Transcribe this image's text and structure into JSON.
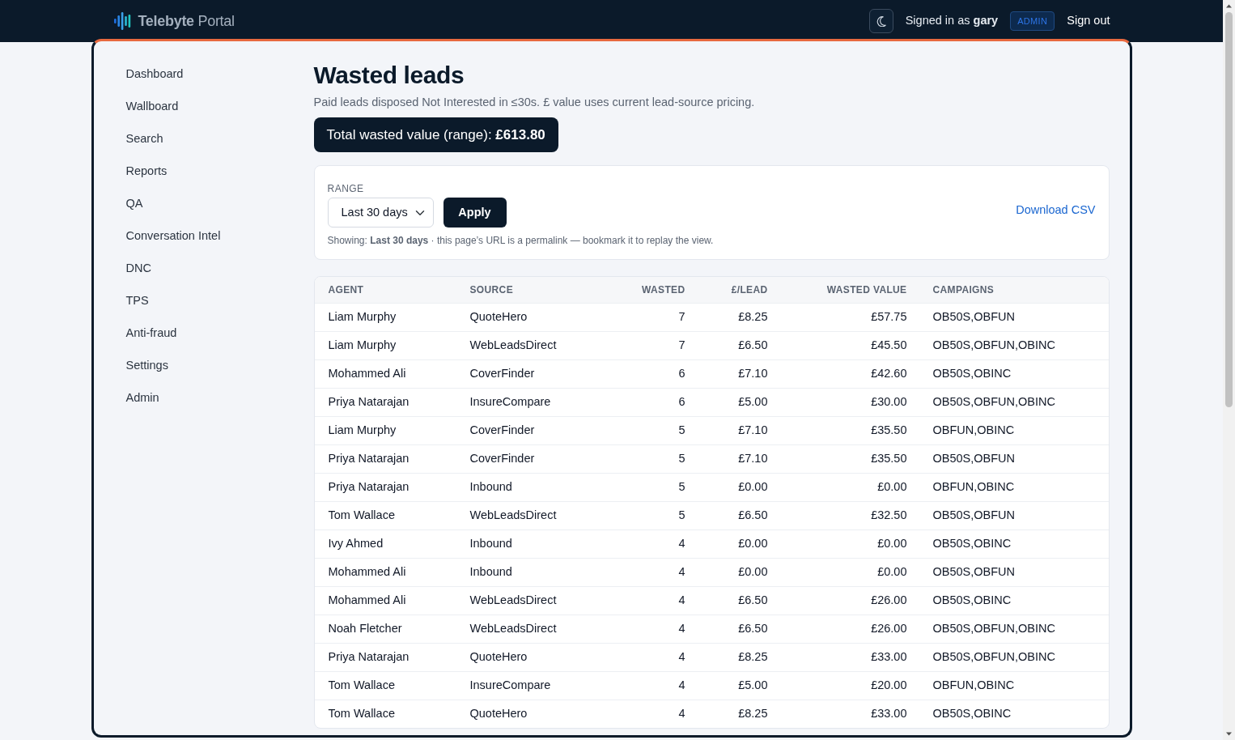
{
  "navbar": {
    "brand": "**Telebyte** Portal",
    "signed_in": "Signed in as **gary**",
    "role_badge": "ADMIN",
    "sign_out": "Sign out"
  },
  "sidebar": {
    "items": [
      {
        "label": "Dashboard",
        "selected": false
      },
      {
        "label": "Wallboard",
        "selected": false
      },
      {
        "label": "Search",
        "selected": false
      },
      {
        "label": "Reports",
        "selected": false
      },
      {
        "label": "QA",
        "selected": false
      },
      {
        "label": "Conversation Intel",
        "selected": false
      },
      {
        "label": "DNC",
        "selected": false
      },
      {
        "label": "TPS",
        "selected": false
      },
      {
        "label": "Anti-fraud",
        "selected": false
      },
      {
        "label": "Settings",
        "selected": false
      },
      {
        "label": "Admin",
        "selected": false
      }
    ]
  },
  "page": {
    "title": "Wasted leads",
    "subtitle": "Paid leads disposed Not Interested in ≤30s. £ value uses current lead-source pricing.",
    "total": "Total wasted value (range): **£613.80**"
  },
  "filter": {
    "label": "RANGE",
    "value": "Last 30 days",
    "apply": "Apply",
    "download": "Download CSV",
    "note": "Showing: **Last 30 days** · this page’s URL is a permalink — bookmark it to replay the view."
  },
  "table": {
    "columns": [
      {
        "label": "AGENT",
        "kind": "text"
      },
      {
        "label": "SOURCE",
        "kind": "text"
      },
      {
        "label": "WASTED",
        "kind": "number"
      },
      {
        "label": "£/LEAD",
        "kind": "number"
      },
      {
        "label": "WASTED VALUE",
        "kind": "number"
      },
      {
        "label": "CAMPAIGNS",
        "kind": "text"
      }
    ],
    "rows": [
      [
        "Liam Murphy",
        "QuoteHero",
        "7",
        "£8.25",
        "£57.75",
        "OB50S,OBFUN"
      ],
      [
        "Liam Murphy",
        "WebLeadsDirect",
        "7",
        "£6.50",
        "£45.50",
        "OB50S,OBFUN,OBINC"
      ],
      [
        "Mohammed Ali",
        "CoverFinder",
        "6",
        "£7.10",
        "£42.60",
        "OB50S,OBINC"
      ],
      [
        "Priya Natarajan",
        "InsureCompare",
        "6",
        "£5.00",
        "£30.00",
        "OB50S,OBFUN,OBINC"
      ],
      [
        "Liam Murphy",
        "CoverFinder",
        "5",
        "£7.10",
        "£35.50",
        "OBFUN,OBINC"
      ],
      [
        "Priya Natarajan",
        "CoverFinder",
        "5",
        "£7.10",
        "£35.50",
        "OB50S,OBFUN"
      ],
      [
        "Priya Natarajan",
        "Inbound",
        "5",
        "£0.00",
        "£0.00",
        "OBFUN,OBINC"
      ],
      [
        "Tom Wallace",
        "WebLeadsDirect",
        "5",
        "£6.50",
        "£32.50",
        "OB50S,OBFUN"
      ],
      [
        "Ivy Ahmed",
        "Inbound",
        "4",
        "£0.00",
        "£0.00",
        "OB50S,OBINC"
      ],
      [
        "Mohammed Ali",
        "Inbound",
        "4",
        "£0.00",
        "£0.00",
        "OB50S,OBFUN"
      ],
      [
        "Mohammed Ali",
        "WebLeadsDirect",
        "4",
        "£6.50",
        "£26.00",
        "OB50S,OBINC"
      ],
      [
        "Noah Fletcher",
        "WebLeadsDirect",
        "4",
        "£6.50",
        "£26.00",
        "OB50S,OBFUN,OBINC"
      ],
      [
        "Priya Natarajan",
        "QuoteHero",
        "4",
        "£8.25",
        "£33.00",
        "OB50S,OBFUN,OBINC"
      ],
      [
        "Tom Wallace",
        "InsureCompare",
        "4",
        "£5.00",
        "£20.00",
        "OBFUN,OBINC"
      ],
      [
        "Tom Wallace",
        "QuoteHero",
        "4",
        "£8.25",
        "£33.00",
        "OB50S,OBINC"
      ]
    ]
  }
}
